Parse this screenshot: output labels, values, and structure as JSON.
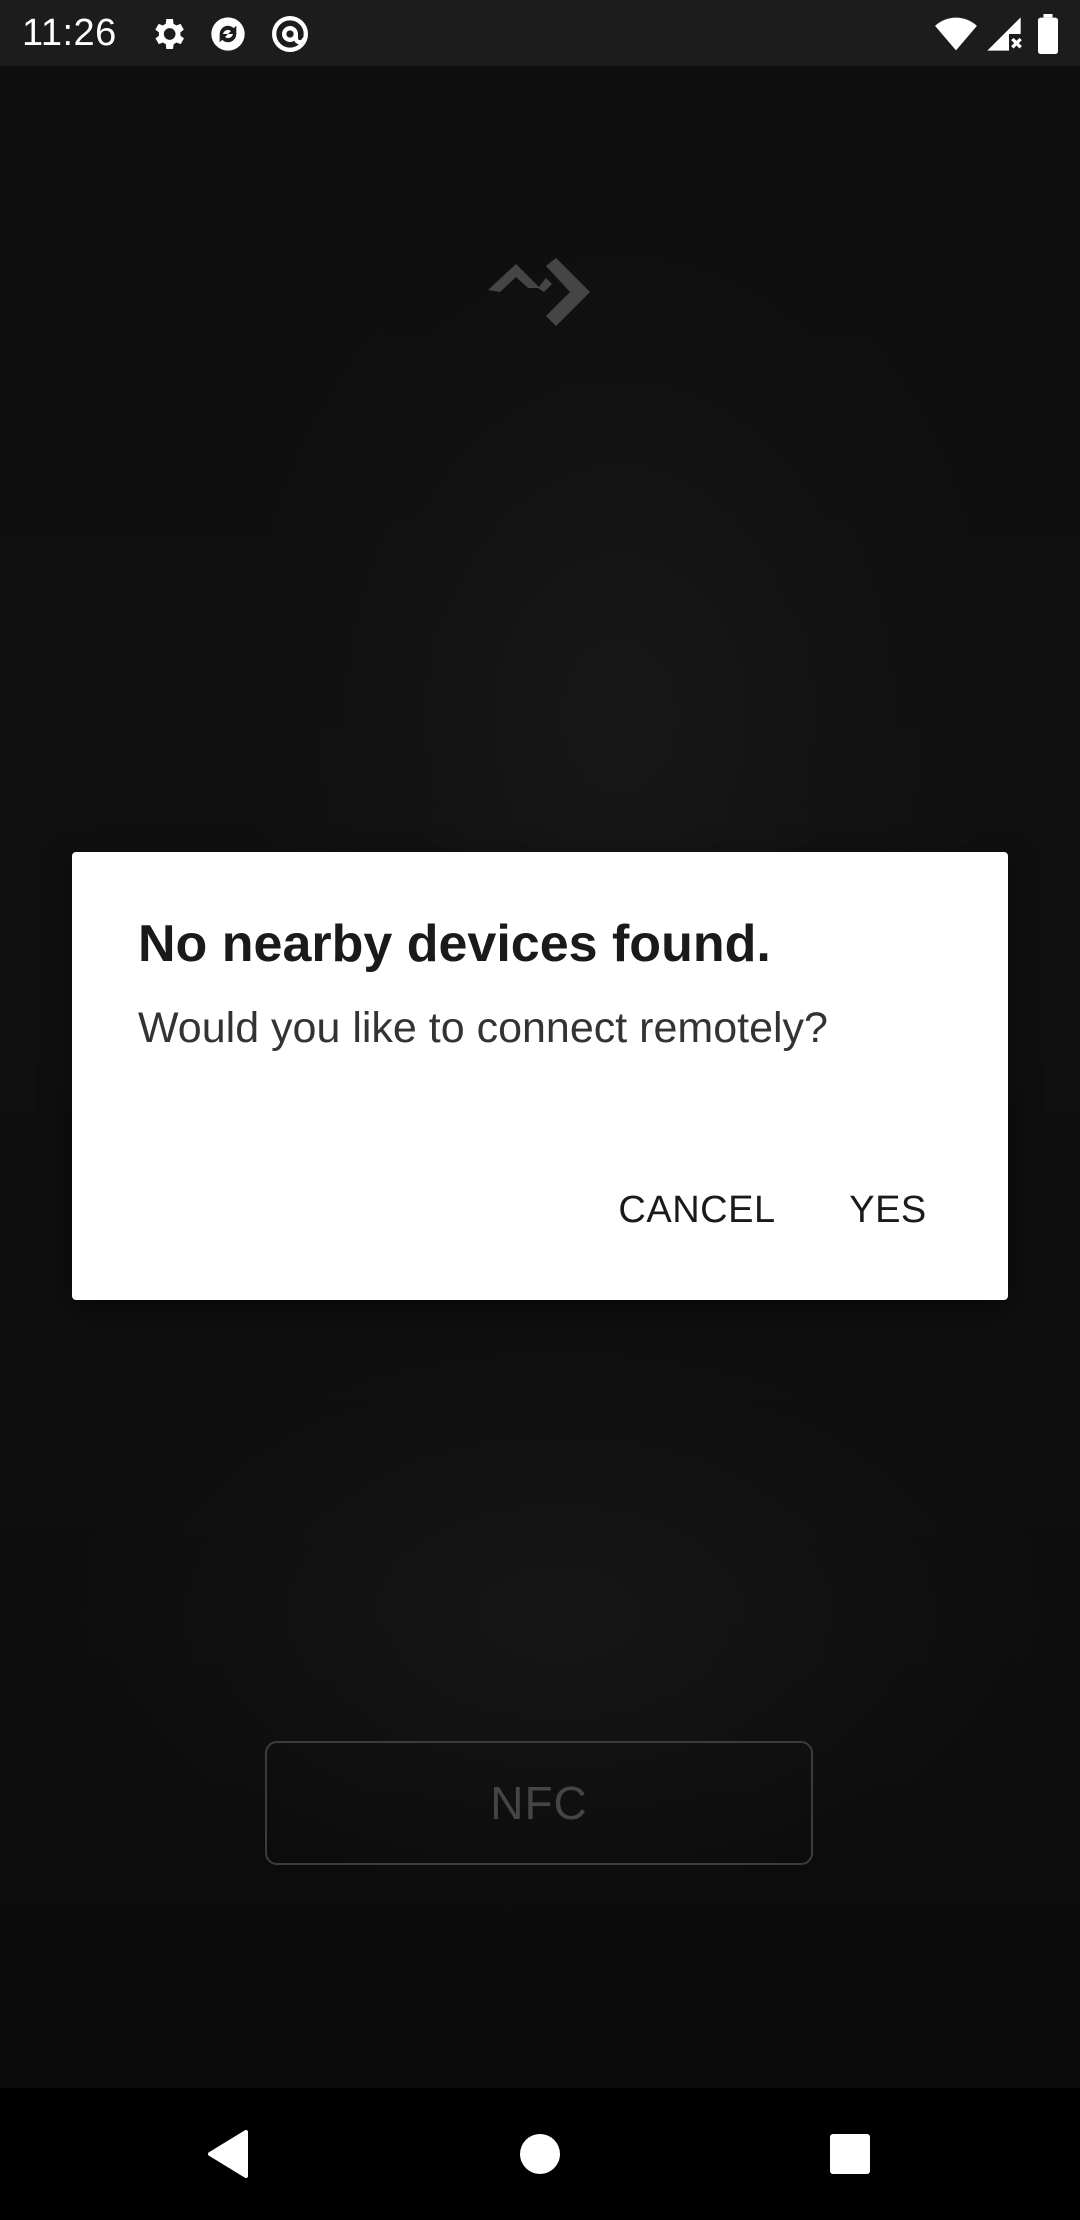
{
  "status_bar": {
    "time": "11:26",
    "left_icons": [
      "gear-icon",
      "sync-icon",
      "at-icon"
    ],
    "right_icons": [
      "wifi-icon",
      "cell-signal-icon",
      "battery-icon"
    ]
  },
  "dialog": {
    "title": "No nearby devices found.",
    "message": "Would you like to connect remotely?",
    "cancel_label": "CANCEL",
    "yes_label": "YES"
  },
  "main": {
    "nfc_label": "NFC"
  },
  "nav_bar": {
    "buttons": [
      "back-icon",
      "home-icon",
      "recents-icon"
    ]
  },
  "colors": {
    "background": "#141414",
    "dialog_background": "#ffffff",
    "text_dark": "#1a1a1a",
    "nfc_text": "#6a6a6a"
  }
}
